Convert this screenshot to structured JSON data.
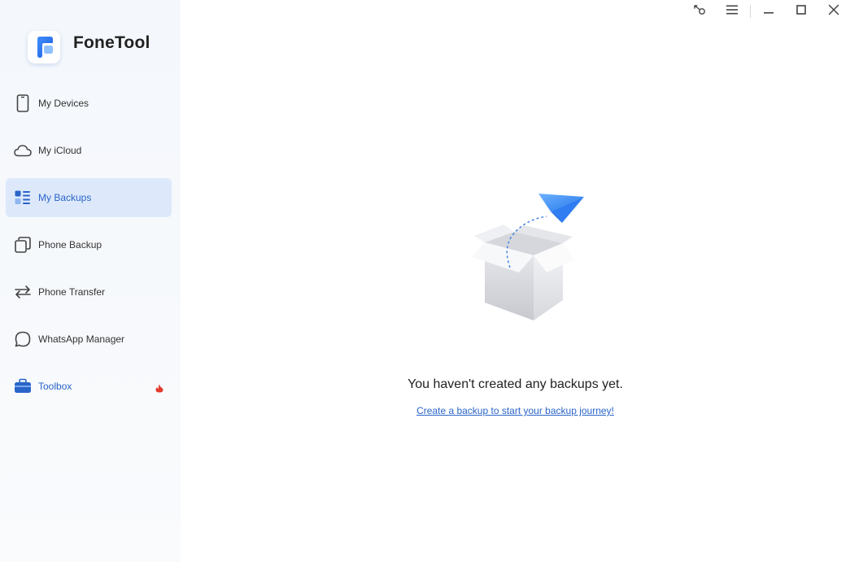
{
  "app": {
    "name": "FoneTool"
  },
  "sidebar": {
    "items": [
      {
        "label": "My Devices"
      },
      {
        "label": "My iCloud"
      },
      {
        "label": "My Backups"
      },
      {
        "label": "Phone Backup"
      },
      {
        "label": "Phone Transfer"
      },
      {
        "label": "WhatsApp Manager"
      },
      {
        "label": "Toolbox"
      }
    ],
    "active_item": "My Backups"
  },
  "main": {
    "empty_title": "You haven't created any backups yet.",
    "empty_link": "Create a backup to start your backup journey!"
  },
  "icons": {
    "titlebar": [
      "key-icon",
      "menu-icon",
      "minimize-icon",
      "maximize-icon",
      "close-icon"
    ],
    "sidebar": [
      "phone-icon",
      "cloud-icon",
      "backups-list-icon",
      "phone-backup-icon",
      "transfer-arrows-icon",
      "whatsapp-chat-icon",
      "toolbox-icon",
      "hot-flame-icon"
    ]
  },
  "colors": {
    "accent": "#2a64c8",
    "active_bg": "#dde9fb",
    "hot": "#e33a2d"
  }
}
